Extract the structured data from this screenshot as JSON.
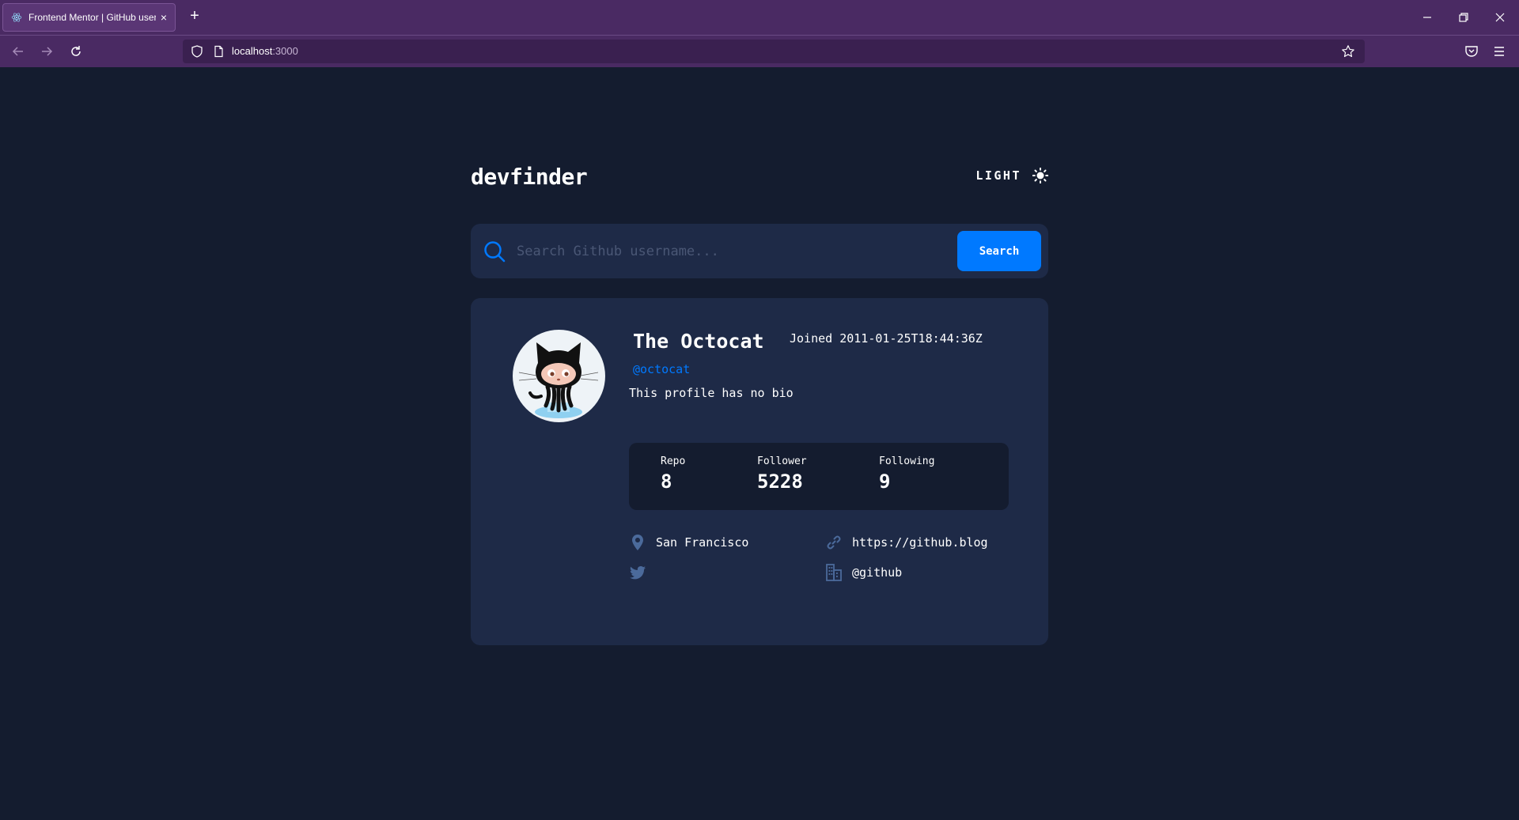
{
  "browser": {
    "tab_title": "Frontend Mentor | GitHub user search app",
    "tab_close": "×",
    "new_tab": "+",
    "url_host": "localhost",
    "url_port": ":3000"
  },
  "header": {
    "logo": "devfinder",
    "theme_label": "LIGHT"
  },
  "search": {
    "placeholder": "Search Github username...",
    "button_label": "Search"
  },
  "profile": {
    "name": "The Octocat",
    "joined": "Joined 2011-01-25T18:44:36Z",
    "login": "@octocat",
    "bio": "This profile has no bio",
    "stats": [
      {
        "label": "Repo",
        "value": "8"
      },
      {
        "label": "Follower",
        "value": "5228"
      },
      {
        "label": "Following",
        "value": "9"
      }
    ],
    "location": "San Francisco",
    "blog": "https://github.blog",
    "twitter": "",
    "company": "@github"
  },
  "colors": {
    "background": "#141c2f",
    "card": "#1e2a47",
    "accent": "#0079ff",
    "muted_icon": "#4b6a9b",
    "browser_chrome": "#4a2a63"
  },
  "icons": {
    "theme": "sun-icon",
    "search": "search-icon",
    "location": "location-pin-icon",
    "blog": "link-icon",
    "twitter": "twitter-icon",
    "company": "building-icon"
  }
}
